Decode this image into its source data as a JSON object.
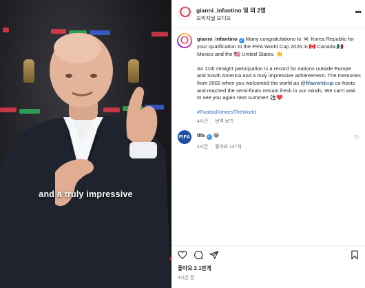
{
  "media": {
    "caption": "and a truly impressive"
  },
  "header": {
    "username": "gianni_infantino 및 외 2명",
    "subtitle": "오리지널 오디오",
    "more_icon": "more-horizontal-icon"
  },
  "post": {
    "author": "gianni_infantino",
    "paragraph1": "Many congratulations to 🇰🇷 Korea Republic for your qualification to the FIFA World Cup 2026 in 🇨🇦 Canada,🇲🇽 Mexico and the 🇺🇸 United States. 👏",
    "paragraph2_part1": "An 11th straight participation is a record for nations outside Europe and South America and a truly impressive achievement. The memories from 2002 when you welcomed the world as ",
    "paragraph2_link": "@fifaworldcup",
    "paragraph2_part2": " co-hosts and reached the semi-finals remain fresh in our minds. We can't wait to see you again next summer! ⚽❤️",
    "hashtag": "#FootballUnitesTheWorld",
    "time": "4시간",
    "translate": "번역 보기"
  },
  "reply": {
    "author": "fifa",
    "text": "😭",
    "time": "4시간",
    "likes": "좋아요 137개",
    "avatar_text": "FIFA"
  },
  "footer": {
    "likes": "좋아요 2.1만개",
    "time": "4시간 전"
  },
  "colors": {
    "verified": "#3897f0",
    "link": "#00376b",
    "hashtag": "#3b6fc4",
    "muted": "#737373"
  }
}
